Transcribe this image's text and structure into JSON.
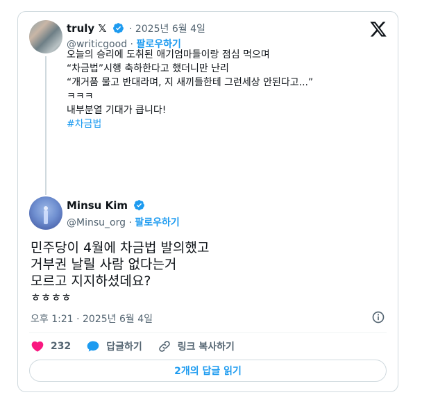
{
  "quoted_post": {
    "name": "truly",
    "name_suffix": "𝕏",
    "date": "· 2025년 6월 4일",
    "handle": "@writicgood",
    "follow_label": "팔로우하기",
    "lines": [
      "오늘의 승리에 도취된 애기엄마들이랑 점심 먹으며",
      "",
      "“차금법”시행 축하한다고 했더니만 난리",
      "",
      "“개거품 물고 반대라며, 지 새끼들한테 그런세상 안된다고...”",
      "",
      "ㅋㅋㅋ",
      "내부분열 기대가 큽니다!",
      ""
    ],
    "hashtag": "#차금법"
  },
  "main_post": {
    "name": "Minsu Kim",
    "handle": "@Minsu_org",
    "follow_label": "팔로우하기",
    "lines": [
      "민주당이 4월에 차금법 발의했고",
      "거부권 날릴 사람 없다는거",
      "모르고 지지하셨데요?",
      "ㅎㅎㅎㅎ"
    ],
    "timestamp": "오후 1:21 · 2025년 6월 4일"
  },
  "actions": {
    "like_count": "232",
    "reply_label": "답글하기",
    "copy_link_label": "링크 복사하기"
  },
  "read_replies_label": "2개의 답글 읽기",
  "colors": {
    "accent": "#1d9bf0",
    "like": "#f91880",
    "text": "#0f1419",
    "muted": "#536471",
    "border": "#cfd9de"
  },
  "icons": [
    "verified-badge-icon",
    "x-logo-icon",
    "info-icon",
    "heart-icon",
    "reply-bubble-icon",
    "link-icon"
  ]
}
